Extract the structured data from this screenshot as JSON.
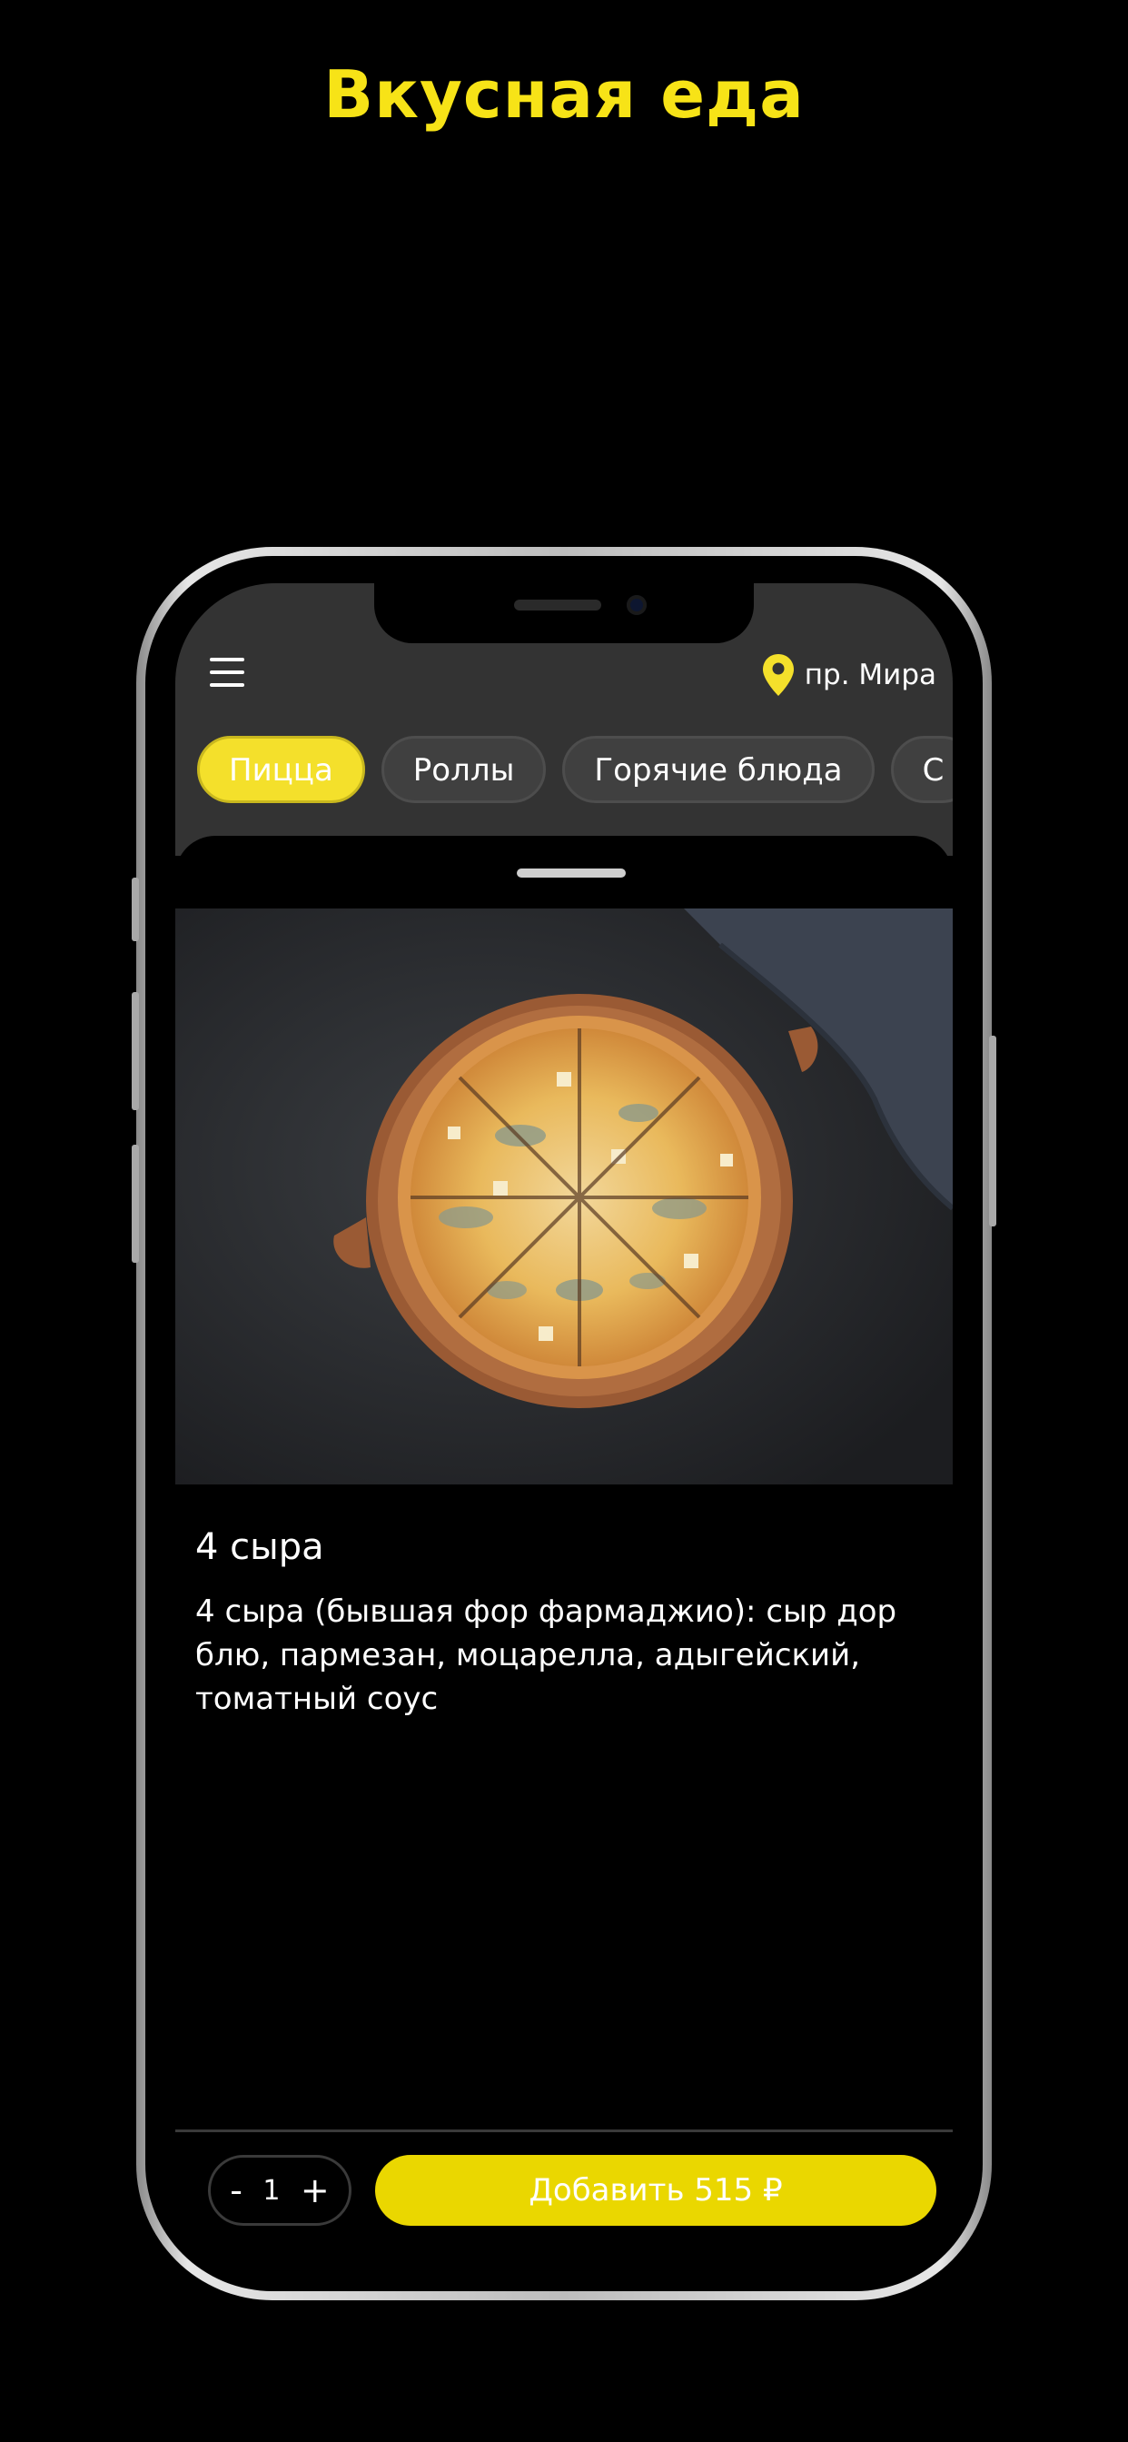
{
  "promo": {
    "headline": "Вкусная еда"
  },
  "header": {
    "location": "пр. Мира"
  },
  "categories": [
    {
      "label": "Пицца",
      "active": true
    },
    {
      "label": "Роллы",
      "active": false
    },
    {
      "label": "Горячие блюда",
      "active": false
    },
    {
      "label": "С",
      "active": false
    }
  ],
  "product": {
    "title": "4 сыра",
    "description": "4 сыра (бывшая фор фармаджио): сыр дор блю, пармезан, моцарелла, адыгейский, томатный соус"
  },
  "cart": {
    "minus_label": "-",
    "quantity": "1",
    "plus_label": "+",
    "add_label": "Добавить 515 ₽"
  },
  "colors": {
    "accent": "#f4e02b",
    "button": "#ead700",
    "headline": "#f7e317",
    "topbar": "#333333"
  },
  "icons": {
    "menu": "hamburger-menu-icon",
    "location": "location-pin-icon"
  }
}
